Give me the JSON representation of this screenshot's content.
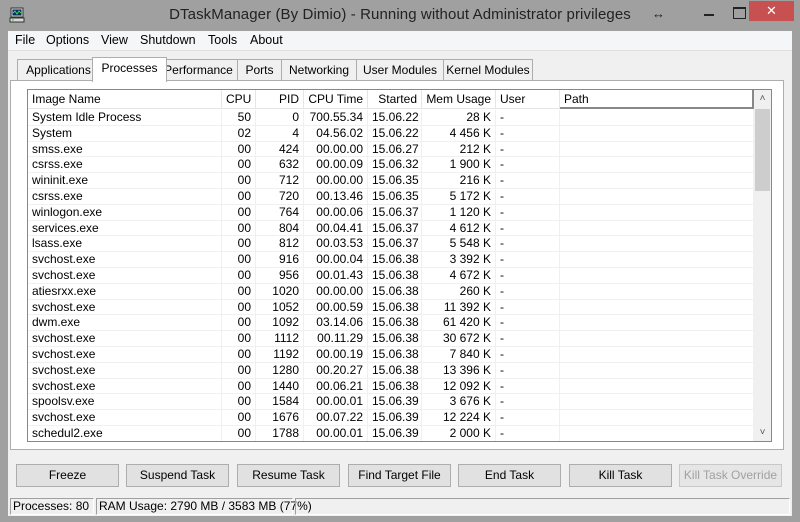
{
  "window": {
    "title": "DTaskManager (By Dimio) - Running without Administrator privileges",
    "app_icon": "computer-monitor-icon",
    "controls": {
      "resize": "↔",
      "minimize": "minimize",
      "maximize": "maximize",
      "close": "✕"
    },
    "close_color": "#c75050"
  },
  "menu": [
    "File",
    "Options",
    "View",
    "Shutdown",
    "Tools",
    "About"
  ],
  "tabs": [
    {
      "label": "Applications",
      "selected": false
    },
    {
      "label": "Processes",
      "selected": true
    },
    {
      "label": "Performance",
      "selected": false
    },
    {
      "label": "Ports",
      "selected": false
    },
    {
      "label": "Networking",
      "selected": false
    },
    {
      "label": "User Modules",
      "selected": false
    },
    {
      "label": "Kernel Modules",
      "selected": false
    }
  ],
  "process_list": {
    "columns": [
      "Image Name",
      "CPU",
      "PID",
      "CPU Time",
      "Started",
      "Mem Usage",
      "User",
      "Path"
    ],
    "rows": [
      [
        "System Idle Process",
        "50",
        "0",
        "700.55.34",
        "15.06.22",
        "28 K",
        "-",
        ""
      ],
      [
        "System",
        "02",
        "4",
        "04.56.02",
        "15.06.22",
        "4 456 K",
        "-",
        ""
      ],
      [
        "smss.exe",
        "00",
        "424",
        "00.00.00",
        "15.06.27",
        "212 K",
        "-",
        ""
      ],
      [
        "csrss.exe",
        "00",
        "632",
        "00.00.09",
        "15.06.32",
        "1 900 K",
        "-",
        ""
      ],
      [
        "wininit.exe",
        "00",
        "712",
        "00.00.00",
        "15.06.35",
        "216 K",
        "-",
        ""
      ],
      [
        "csrss.exe",
        "00",
        "720",
        "00.13.46",
        "15.06.35",
        "5 172 K",
        "-",
        ""
      ],
      [
        "winlogon.exe",
        "00",
        "764",
        "00.00.06",
        "15.06.37",
        "1 120 K",
        "-",
        ""
      ],
      [
        "services.exe",
        "00",
        "804",
        "00.04.41",
        "15.06.37",
        "4 612 K",
        "-",
        ""
      ],
      [
        "lsass.exe",
        "00",
        "812",
        "00.03.53",
        "15.06.37",
        "5 548 K",
        "-",
        ""
      ],
      [
        "svchost.exe",
        "00",
        "916",
        "00.00.04",
        "15.06.38",
        "3 392 K",
        "-",
        ""
      ],
      [
        "svchost.exe",
        "00",
        "956",
        "00.01.43",
        "15.06.38",
        "4 672 K",
        "-",
        ""
      ],
      [
        "atiesrxx.exe",
        "00",
        "1020",
        "00.00.00",
        "15.06.38",
        "260 K",
        "-",
        ""
      ],
      [
        "svchost.exe",
        "00",
        "1052",
        "00.00.59",
        "15.06.38",
        "11 392 K",
        "-",
        ""
      ],
      [
        "dwm.exe",
        "00",
        "1092",
        "03.14.06",
        "15.06.38",
        "61 420 K",
        "-",
        ""
      ],
      [
        "svchost.exe",
        "00",
        "1112",
        "00.11.29",
        "15.06.38",
        "30 672 K",
        "-",
        ""
      ],
      [
        "svchost.exe",
        "00",
        "1192",
        "00.00.19",
        "15.06.38",
        "7 840 K",
        "-",
        ""
      ],
      [
        "svchost.exe",
        "00",
        "1280",
        "00.20.27",
        "15.06.38",
        "13 396 K",
        "-",
        ""
      ],
      [
        "svchost.exe",
        "00",
        "1440",
        "00.06.21",
        "15.06.38",
        "12 092 K",
        "-",
        ""
      ],
      [
        "spoolsv.exe",
        "00",
        "1584",
        "00.00.01",
        "15.06.39",
        "3 676 K",
        "-",
        ""
      ],
      [
        "svchost.exe",
        "00",
        "1676",
        "00.07.22",
        "15.06.39",
        "12 224 K",
        "-",
        ""
      ],
      [
        "schedul2.exe",
        "00",
        "1788",
        "00.00.01",
        "15.06.39",
        "2 000 K",
        "-",
        ""
      ]
    ],
    "scroll": {
      "up_icon": "▲",
      "down_icon": "▼",
      "position_fraction": 0.0
    }
  },
  "buttons": [
    {
      "label": "Freeze",
      "enabled": true
    },
    {
      "label": "Suspend Task",
      "enabled": true
    },
    {
      "label": "Resume Task",
      "enabled": true
    },
    {
      "label": "Find Target File",
      "enabled": true
    },
    {
      "label": "End Task",
      "enabled": true
    },
    {
      "label": "Kill Task",
      "enabled": true
    },
    {
      "label": "Kill Task Override",
      "enabled": false
    }
  ],
  "status": {
    "processes": "Processes: 80",
    "ram": "RAM Usage:  2790 MB / 3583 MB (77%)",
    "extra": ""
  }
}
